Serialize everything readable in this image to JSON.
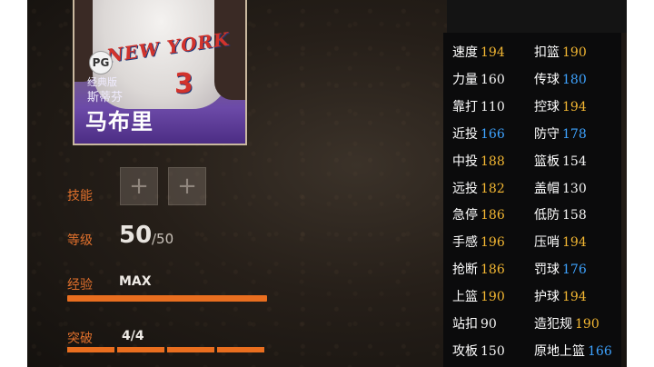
{
  "player": {
    "position_badge": "PG",
    "edition": "经典版",
    "first_name": "斯蒂芬",
    "last_name": "马布里",
    "jersey_team": "NEW YORK",
    "jersey_number": "3"
  },
  "details": {
    "skills_label": "技能",
    "skill_slots": [
      "+",
      "+"
    ],
    "level_label": "等级",
    "level_value": "50",
    "level_max": "/50",
    "exp_label": "经验",
    "exp_value": "MAX",
    "exp_fraction": 1.0,
    "break_label": "突破",
    "break_value": "4/4",
    "break_filled": 4
  },
  "colors": {
    "accent_orange": "#e96e1f",
    "stat_white": "#f2f2f2",
    "stat_yellow": "#f2b632",
    "stat_blue": "#3ea3ff"
  },
  "stats_left": [
    {
      "name": "速度",
      "value": "194",
      "color": "yellow"
    },
    {
      "name": "力量",
      "value": "160",
      "color": "white"
    },
    {
      "name": "靠打",
      "value": "110",
      "color": "white"
    },
    {
      "name": "近投",
      "value": "166",
      "color": "blue"
    },
    {
      "name": "中投",
      "value": "188",
      "color": "yellow"
    },
    {
      "name": "远投",
      "value": "182",
      "color": "yellow"
    },
    {
      "name": "急停",
      "value": "186",
      "color": "yellow"
    },
    {
      "name": "手感",
      "value": "196",
      "color": "yellow"
    },
    {
      "name": "抢断",
      "value": "186",
      "color": "yellow"
    },
    {
      "name": "上篮",
      "value": "190",
      "color": "yellow"
    },
    {
      "name": "站扣",
      "value": "90",
      "color": "white"
    },
    {
      "name": "攻板",
      "value": "150",
      "color": "white"
    }
  ],
  "stats_right": [
    {
      "name": "扣篮",
      "value": "190",
      "color": "yellow"
    },
    {
      "name": "传球",
      "value": "180",
      "color": "blue"
    },
    {
      "name": "控球",
      "value": "194",
      "color": "yellow"
    },
    {
      "name": "防守",
      "value": "178",
      "color": "blue"
    },
    {
      "name": "篮板",
      "value": "154",
      "color": "white"
    },
    {
      "name": "盖帽",
      "value": "130",
      "color": "white"
    },
    {
      "name": "低防",
      "value": "158",
      "color": "white"
    },
    {
      "name": "压哨",
      "value": "194",
      "color": "yellow"
    },
    {
      "name": "罚球",
      "value": "176",
      "color": "blue"
    },
    {
      "name": "护球",
      "value": "194",
      "color": "yellow"
    },
    {
      "name": "造犯规",
      "value": "190",
      "color": "yellow"
    },
    {
      "name": "原地上篮",
      "value": "166",
      "color": "blue"
    }
  ]
}
